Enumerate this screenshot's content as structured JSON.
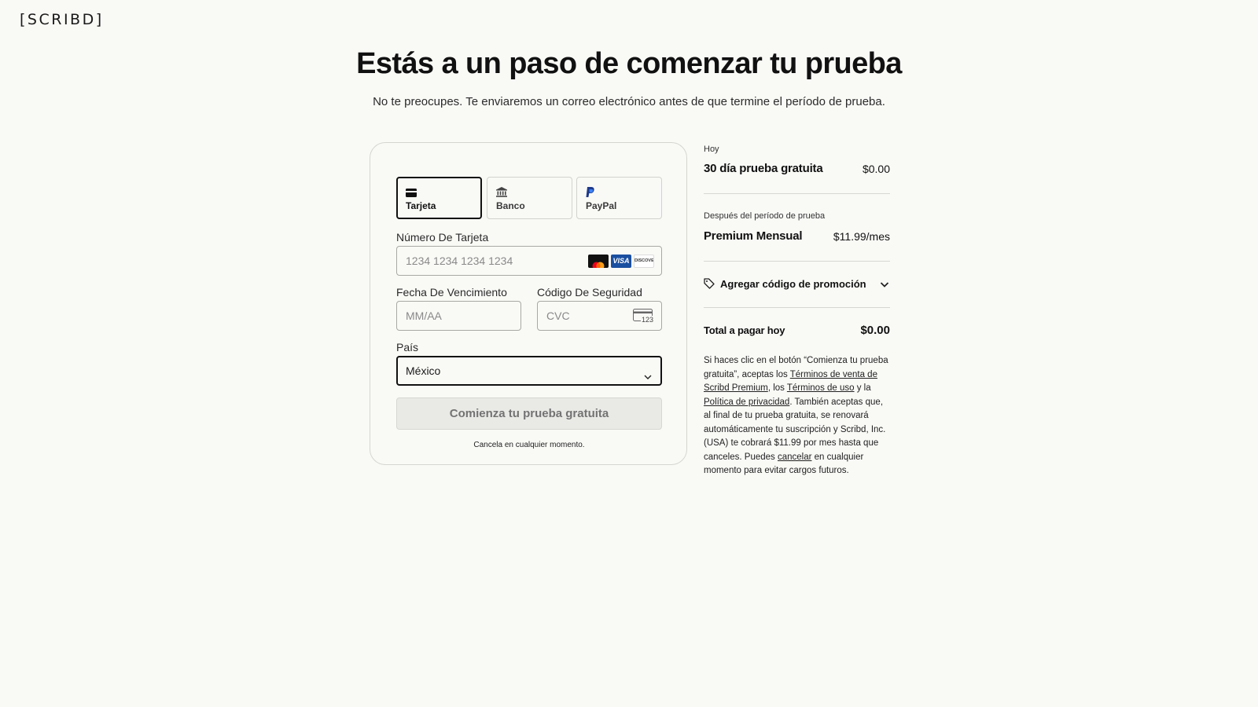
{
  "brand": {
    "logo": "[SCRIBD]"
  },
  "header": {
    "title": "Estás a un paso de comenzar tu prueba",
    "subtitle": "No te preocupes. Te enviaremos un correo electrónico antes de que termine el período de prueba."
  },
  "payment": {
    "tabs": [
      {
        "label": "Tarjeta",
        "icon": "credit-card-icon",
        "active": true
      },
      {
        "label": "Banco",
        "icon": "bank-icon",
        "active": false
      },
      {
        "label": "PayPal",
        "icon": "paypal-icon",
        "active": false
      }
    ],
    "card_number": {
      "label": "Número De Tarjeta",
      "placeholder": "1234 1234 1234 1234",
      "brands": [
        "mastercard",
        "visa",
        "discover"
      ],
      "discover_text": "DISCOVER",
      "visa_text": "VISA"
    },
    "expiry": {
      "label": "Fecha De Vencimiento",
      "placeholder": "MM/AA"
    },
    "cvc": {
      "label": "Código De Seguridad",
      "placeholder": "CVC",
      "icon_text": "123"
    },
    "country": {
      "label": "País",
      "value": "México"
    },
    "submit_label": "Comienza tu prueba gratuita",
    "cancel_note": "Cancela en cualquier momento."
  },
  "summary": {
    "today_label": "Hoy",
    "trial_label": "30 día prueba gratuita",
    "trial_price": "$0.00",
    "after_label": "Después del período de prueba",
    "plan_label": "Premium Mensual",
    "plan_price": "$11.99/mes",
    "promo_label": "Agregar código de promoción",
    "total_label": "Total a pagar hoy",
    "total_value": "$0.00",
    "legal": {
      "p1": "Si haces clic en el botón “Comienza tu prueba gratuita”, aceptas los ",
      "link1": "Términos de venta de Scribd Premium",
      "p2": ", los ",
      "link2": "Términos de uso",
      "p3": " y la ",
      "link3": "Política de privacidad",
      "p4": ". También aceptas que, al final de tu prueba gratuita, se renovará automáticamente tu suscripción y Scribd, Inc. (USA) te cobrará $11.99 por mes hasta que canceles. Puedes ",
      "link4": "cancelar",
      "p5": " en cualquier momento para evitar cargos futuros."
    }
  },
  "colors": {
    "background": "#f9f9f6",
    "text": "#111111",
    "border": "#d5d5d0",
    "disabled_button": "#e9e9e6"
  }
}
